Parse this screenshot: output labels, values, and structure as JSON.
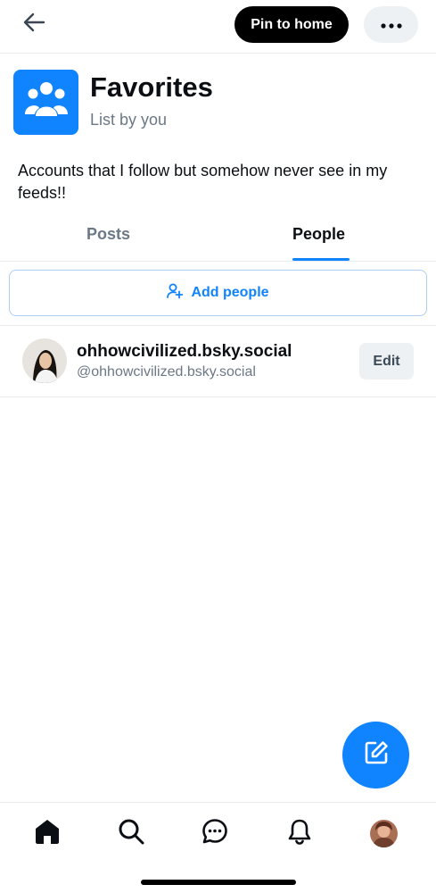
{
  "header": {
    "back_icon": "arrow-left-icon",
    "pin_label": "Pin to home",
    "more_icon": "ellipsis-icon"
  },
  "list": {
    "avatar_icon": "group-icon",
    "avatar_color": "#1083fe",
    "title": "Favorites",
    "subtitle": "List by you",
    "description": "Accounts that I follow but somehow never see in my feeds!!"
  },
  "tabs": [
    {
      "label": "Posts",
      "active": false
    },
    {
      "label": "People",
      "active": true
    }
  ],
  "add_people": {
    "label": "Add people",
    "icon": "person-plus-icon"
  },
  "members": [
    {
      "display_name": "ohhowcivilized.bsky.social",
      "handle": "@ohhowcivilized.bsky.social",
      "edit_label": "Edit"
    }
  ],
  "fab": {
    "icon": "compose-icon"
  },
  "bottom_nav": [
    {
      "icon": "home-icon",
      "active": true
    },
    {
      "icon": "search-icon"
    },
    {
      "icon": "chat-icon"
    },
    {
      "icon": "bell-icon"
    },
    {
      "icon": "profile-avatar"
    }
  ],
  "colors": {
    "accent": "#1083fe",
    "text_primary": "#0b0f14",
    "text_secondary": "#6b7886",
    "button_bg": "#eef1f4"
  }
}
